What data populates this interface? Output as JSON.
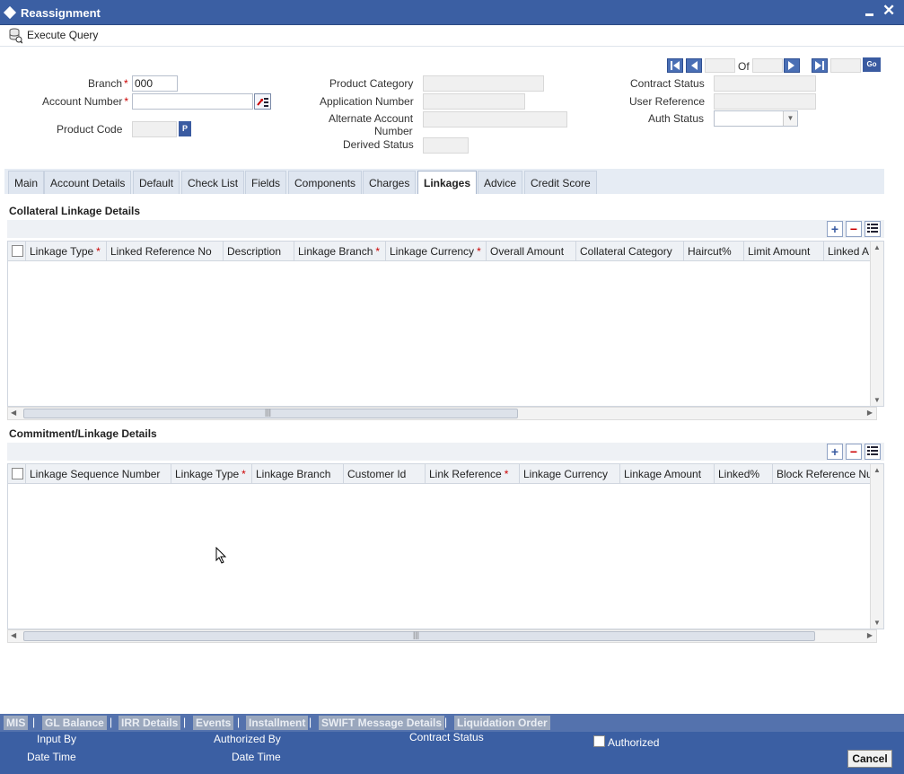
{
  "window": {
    "title": "Reassignment"
  },
  "toolbar": {
    "execute_query": "Execute Query"
  },
  "header": {
    "branch_label": "Branch",
    "branch_value": "000",
    "account_number_label": "Account Number",
    "account_number_value": "",
    "product_code_label": "Product Code",
    "product_code_button": "P",
    "product_category_label": "Product Category",
    "application_number_label": "Application Number",
    "alternate_account_label_1": "Alternate Account",
    "alternate_account_label_2": "Number",
    "derived_status_label": "Derived Status",
    "contract_status_label": "Contract Status",
    "user_reference_label": "User Reference",
    "auth_status_label": "Auth Status",
    "pager_of": "Of",
    "go": "Go"
  },
  "tabs": [
    "Main",
    "Account Details",
    "Default",
    "Check List",
    "Fields",
    "Components",
    "Charges",
    "Linkages",
    "Advice",
    "Credit Score"
  ],
  "active_tab": "Linkages",
  "collateral": {
    "title": "Collateral Linkage Details",
    "columns": [
      "Linkage Type",
      "Linked Reference No",
      "Description",
      "Linkage Branch",
      "Linkage Currency",
      "Overall Amount",
      "Collateral Category",
      "Haircut%",
      "Limit Amount",
      "Linked A"
    ]
  },
  "commitment": {
    "title": "Commitment/Linkage Details",
    "columns": [
      "Linkage Sequence Number",
      "Linkage Type",
      "Linkage Branch",
      "Customer Id",
      "Link Reference",
      "Linkage Currency",
      "Linkage Amount",
      "Linked%",
      "Block Reference Nu"
    ]
  },
  "footer_links": [
    "MIS",
    "GL Balance",
    "IRR Details",
    "Events",
    "Installment",
    "SWIFT Message Details",
    "Liquidation Order"
  ],
  "footer": {
    "input_by": "Input By",
    "date_time_1": "Date Time",
    "authorized_by": "Authorized By",
    "date_time_2": "Date Time",
    "contract_status": "Contract Status",
    "authorized": "Authorized",
    "cancel": "Cancel"
  },
  "colors": {
    "titlebar": "#3b5fa3",
    "footer": "#3b5fa3",
    "required": "#cc0000"
  }
}
